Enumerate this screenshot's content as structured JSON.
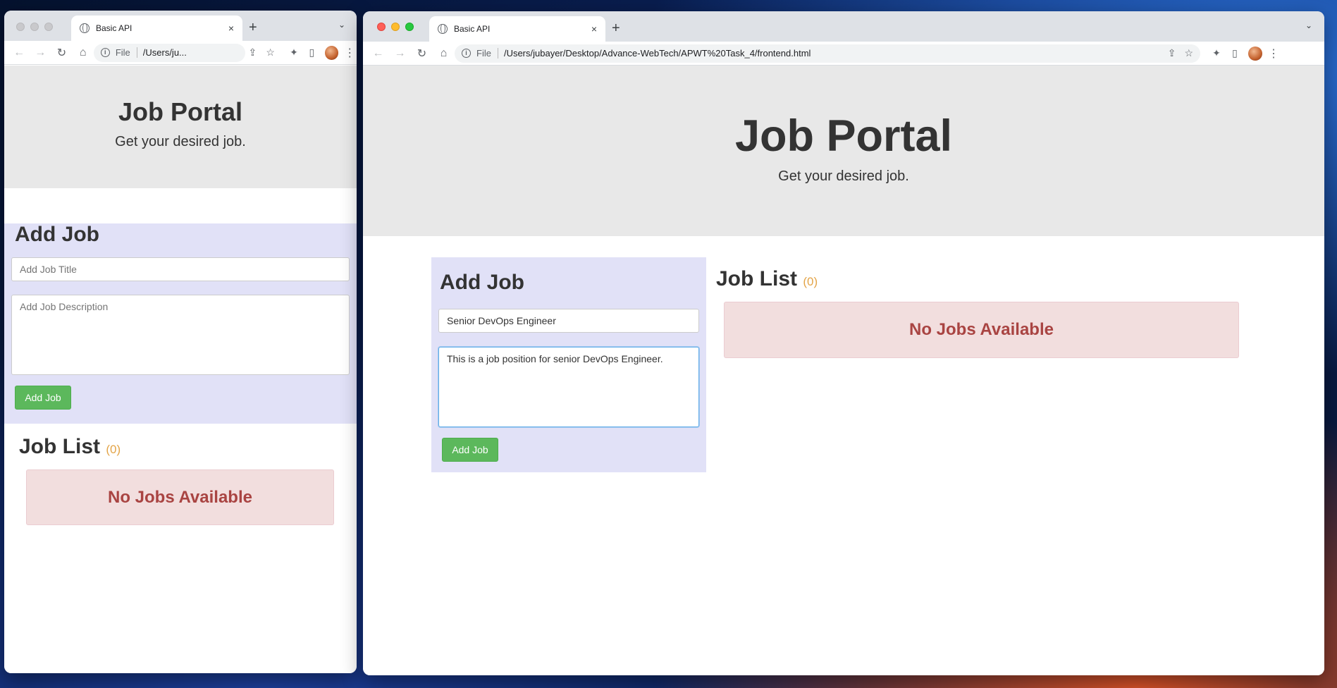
{
  "browser": {
    "tab_title": "Basic API",
    "tab_close": "×",
    "new_tab": "+",
    "tab_menu": "⌄",
    "scheme": "File",
    "url_short": "/Users/ju...",
    "url_full": "/Users/jubayer/Desktop/Advance-WebTech/APWT%20Task_4/frontend.html"
  },
  "page": {
    "title": "Job Portal",
    "subtitle": "Get your desired job.",
    "add_job": {
      "heading": "Add Job",
      "title_placeholder": "Add Job Title",
      "description_placeholder": "Add Job Description",
      "button": "Add Job"
    },
    "job_list": {
      "heading": "Job List",
      "count": "(0)",
      "empty_message": "No Jobs Available"
    }
  },
  "right_form": {
    "title_value": "Senior DevOps Engineer",
    "description_value": "This is a job position for senior DevOps Engineer."
  },
  "colors": {
    "jumbotron": "#e8e8e8",
    "add_job_panel": "#e1e1f7",
    "button_green": "#5cb85c",
    "alert_bg": "#f2dede",
    "alert_text": "#a94442",
    "count_orange": "#e3a447"
  }
}
